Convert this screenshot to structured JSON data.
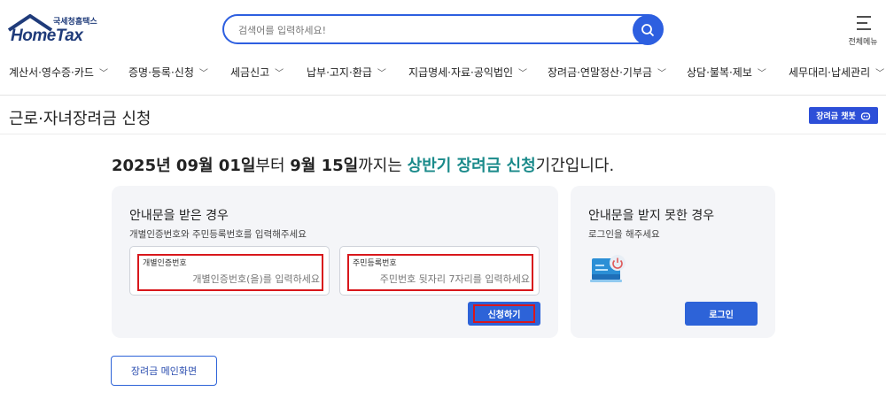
{
  "logo": {
    "sub": "국세청홈택스",
    "main": "HomeTax"
  },
  "search": {
    "placeholder": "검색어를 입력하세요!",
    "icon": "search-icon"
  },
  "all_menu": {
    "label": "전체메뉴",
    "icon": "hamburger-icon"
  },
  "gnb": {
    "items": [
      {
        "label": "계산서·영수증·카드"
      },
      {
        "label": "증명·등록·신청"
      },
      {
        "label": "세금신고"
      },
      {
        "label": "납부·고지·환급"
      },
      {
        "label": "지급명세·자료·공익법인"
      },
      {
        "label": "장려금·연말정산·기부금"
      },
      {
        "label": "상담·불복·제보"
      },
      {
        "label": "세무대리·납세관리"
      }
    ]
  },
  "page": {
    "title": "근로·자녀장려금 신청",
    "chatbot_label": "장려금 챗봇"
  },
  "notice": {
    "p1": "2025년 09월 01일",
    "p2": "부터 ",
    "p3": "9월 15일",
    "p4": "까지는 ",
    "p5": "상반기 장려금 신청",
    "p6": "기간입니다.",
    "highlight_color": "#1a8a8a"
  },
  "received": {
    "title": "안내문을 받은 경우",
    "desc": "개별인증번호와 주민등록번호를 입력해주세요",
    "field1": {
      "label": "개별인증번호",
      "placeholder": "개별인증번호(을)를 입력하세요"
    },
    "field2": {
      "label": "주민등록번호",
      "placeholder": "주민번호 뒷자리 7자리를 입력하세요"
    },
    "apply_label": "신청하기"
  },
  "not_received": {
    "title": "안내문을 받지 못한 경우",
    "desc": "로그인을 해주세요",
    "login_label": "로그인"
  },
  "main_button": {
    "label": "장려금 메인화면"
  },
  "colors": {
    "accent": "#2d63d8",
    "highlight_box": "#d8171c",
    "brand": "#1f3b7a"
  }
}
